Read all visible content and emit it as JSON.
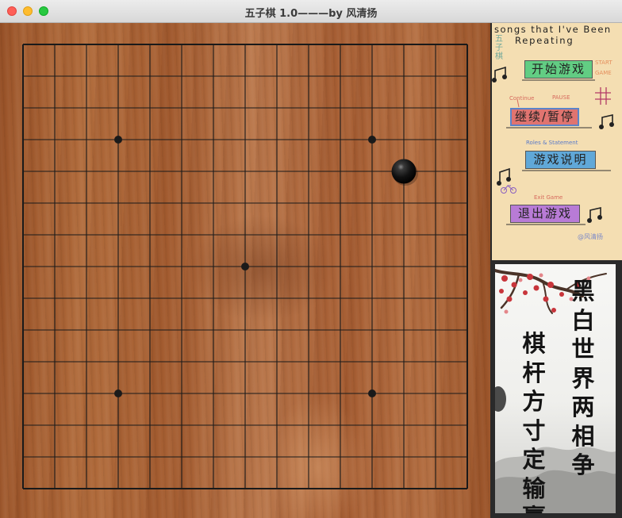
{
  "window": {
    "title": "五子棋 1.0———by 风清扬"
  },
  "board": {
    "size": 15,
    "star_points": [
      [
        3,
        3
      ],
      [
        11,
        3
      ],
      [
        7,
        7
      ],
      [
        3,
        11
      ],
      [
        11,
        11
      ]
    ],
    "stones": [
      {
        "col": 12,
        "row": 4,
        "color": "black"
      }
    ],
    "colors": {
      "line": "#1a1a1a",
      "stone": "#111111"
    }
  },
  "menu": {
    "heading_line1": "songs that I've Been",
    "heading_line2": "Repeating",
    "logo": "五子棋",
    "start": {
      "label": "开始游戏",
      "hint": "START GAME"
    },
    "continue": {
      "label": "继续/暂停",
      "hint": "Continue",
      "pause_hint": "PAUSE"
    },
    "rules": {
      "label": "游戏说明",
      "hint": "Roles & Statement"
    },
    "exit": {
      "label": "退出游戏",
      "hint": "Exit Game"
    },
    "signature": "@风清扬"
  },
  "poem": {
    "right_column": "黑白世界两相争",
    "left_column": "棋杆方寸定输赢"
  }
}
